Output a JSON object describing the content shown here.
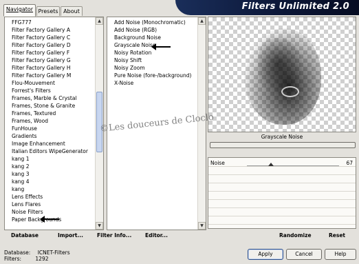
{
  "window": {
    "title": "Filters Unlimited 2.0",
    "tabs": [
      {
        "label": "Navigator",
        "active": true
      },
      {
        "label": "Presets",
        "active": false
      },
      {
        "label": "About",
        "active": false
      }
    ]
  },
  "categories": {
    "items": [
      "FFG777",
      "Filter Factory Gallery A",
      "Filter Factory Gallery C",
      "Filter Factory Gallery D",
      "Filter Factory Gallery F",
      "Filter Factory Gallery G",
      "Filter Factory Gallery H",
      "Filter Factory Gallery M",
      "Flou-Mouvement",
      "Forrest's Filters",
      "Frames, Marble & Crystal",
      "Frames, Stone & Granite",
      "Frames, Textured",
      "Frames, Wood",
      "FunHouse",
      "Gradients",
      "Image Enhancement",
      "Italian Editors WipeGenerator",
      "kang 1",
      "kang 2",
      "kang 3",
      "kang 4",
      "kang",
      "Lens Effects",
      "Lens Flares",
      "Noise Filters",
      "Paper Backgrounds"
    ],
    "selected": "Noise Filters"
  },
  "filters": {
    "items": [
      "Add Noise (Monochromatic)",
      "Add Noise (RGB)",
      "Background Noise",
      "Grayscale Noise",
      "Noisy Rotation",
      "Noisy Shift",
      "Noisy Zoom",
      "Pure Noise (fore-/background)",
      "X-Noise"
    ],
    "selected": "Grayscale Noise"
  },
  "preview": {
    "filter_name": "Grayscale Noise"
  },
  "parameters": [
    {
      "label": "Noise",
      "value": "67",
      "fraction": 0.26
    }
  ],
  "left_buttons": {
    "database": "Database",
    "import": "Import...",
    "filter_info": "Filter Info...",
    "editor": "Editor..."
  },
  "right_buttons": {
    "randomize": "Randomize",
    "reset": "Reset"
  },
  "status": {
    "database_label": "Database:",
    "database_value": "ICNET-Filters",
    "filters_label": "Filters:",
    "filters_value": "1292"
  },
  "dialog_buttons": {
    "apply": "Apply",
    "cancel": "Cancel",
    "help": "Help"
  },
  "watermark": "©Les douceurs de Cloclo",
  "colors": {
    "banner": "#0b1636",
    "window_bg": "#e3e1dc",
    "selection_arrow": "#000000"
  }
}
